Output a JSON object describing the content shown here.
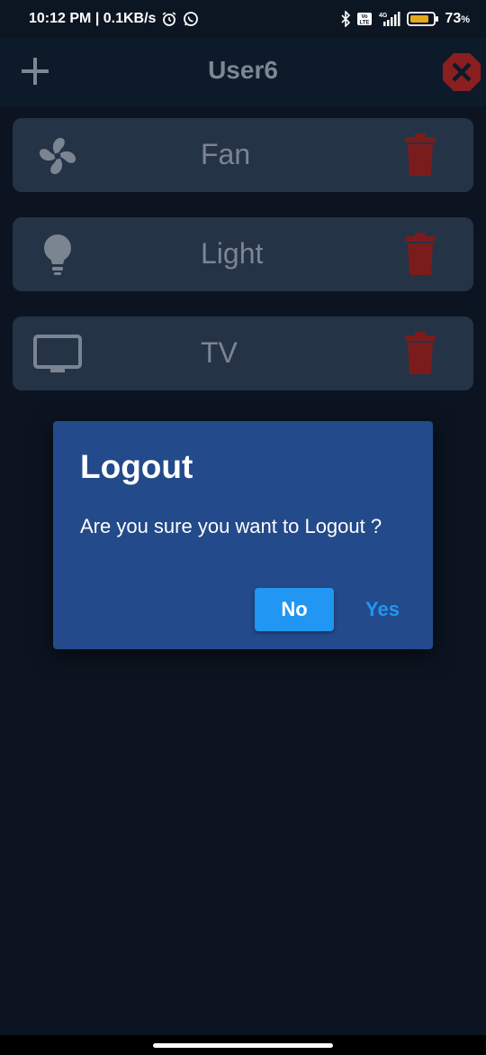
{
  "status_bar": {
    "time_speed": "10:12 PM | 0.1KB/s",
    "battery": "73",
    "battery_unit": "%",
    "network": "4G",
    "icons": [
      "alarm-icon",
      "whatsapp-icon",
      "bluetooth-icon",
      "volte-icon",
      "signal-icon",
      "battery-icon"
    ]
  },
  "header": {
    "title": "User6",
    "add_icon": "plus-icon",
    "logout_icon": "close-octagon-icon"
  },
  "devices": [
    {
      "name": "Fan",
      "icon": "fan-icon"
    },
    {
      "name": "Light",
      "icon": "bulb-icon"
    },
    {
      "name": "TV",
      "icon": "tv-icon"
    }
  ],
  "dialog": {
    "title": "Logout",
    "message": "Are you sure you want to Logout ?",
    "no_label": "No",
    "yes_label": "Yes"
  },
  "colors": {
    "background": "#0b1420",
    "card": "#253347",
    "dialog": "#234a8a",
    "accent": "#2196f3",
    "delete": "#7a1c1c",
    "logout": "#8b1f1f"
  }
}
